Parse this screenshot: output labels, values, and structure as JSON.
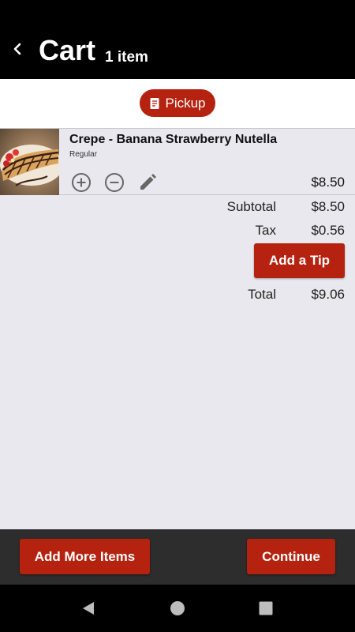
{
  "header": {
    "title": "Cart",
    "item_count": "1 item"
  },
  "order_mode": {
    "label": "Pickup",
    "icon": "receipt-icon"
  },
  "cart_items": [
    {
      "name": "Crepe - Banana Strawberry Nutella",
      "variant": "Regular",
      "price": "$8.50"
    }
  ],
  "summary": {
    "subtotal_label": "Subtotal",
    "subtotal_value": "$8.50",
    "tax_label": "Tax",
    "tax_value": "$0.56",
    "tip_button": "Add a Tip",
    "total_label": "Total",
    "total_value": "$9.06"
  },
  "footer": {
    "add_more_label": "Add More Items",
    "continue_label": "Continue"
  },
  "colors": {
    "accent": "#b5220f",
    "header_bg": "#000000",
    "footer_bg": "#2d2d2d",
    "page_bg": "#e8e8ee"
  }
}
